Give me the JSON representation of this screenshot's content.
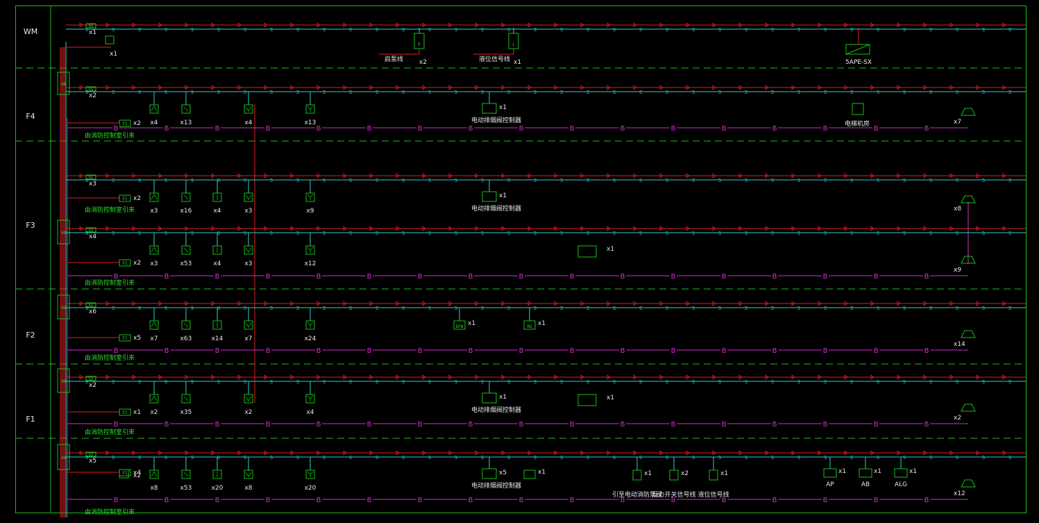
{
  "colors": {
    "border": "#18c018",
    "device": "#28e028",
    "power_line": "#e02020",
    "signal_line": "#2fd0d0",
    "broadcast_line": "#d030d0",
    "label": "#e8e8e8",
    "background": "#000000"
  },
  "line_markers": {
    "signal": "S",
    "power": "D",
    "broadcast": "B",
    "fire": "F"
  },
  "module_labels": {
    "x0": "XO",
    "si": "SI",
    "fi": "FI"
  },
  "floors": [
    "WM",
    "F4",
    "F3",
    "F2",
    "F1"
  ],
  "top_row": {
    "si_count": "x1",
    "phone_count": "x1",
    "devices": [
      {
        "name": "flow-switch",
        "code": "F",
        "note": "启泵线",
        "count": "x2"
      },
      {
        "name": "level-switch",
        "code": "L",
        "note": "液位信号线",
        "count": "x1"
      }
    ],
    "panel": "5APE-SX"
  },
  "floor_rows": [
    {
      "floor": "F4",
      "si_count": "x2",
      "fi_count": "x2",
      "counts": [
        "x4",
        "x13",
        "x4",
        "x13"
      ],
      "controller_count": "x1",
      "controller_label": "电动排烟阀控制器",
      "extra_label": "电梯机房",
      "speaker_count": "x7",
      "note": "由消防控制室引来"
    },
    {
      "floor": "F3-upper",
      "si_count": "x3",
      "fi_count": "x2",
      "counts": [
        "x3",
        "x16",
        "x4",
        "x3",
        "x9"
      ],
      "controller_count": "x1",
      "controller_label": "电动排烟阀控制器",
      "speaker_count": "x8",
      "note": "由消防控制室引来"
    },
    {
      "floor": "F3",
      "si_count": "x4",
      "fi_count": "x2",
      "counts": [
        "x3",
        "x53",
        "x4",
        "x3",
        "x12"
      ],
      "valve_count": "x1",
      "speaker_count": "x9",
      "note": "由消防控制室引来"
    },
    {
      "floor": "F2",
      "si_count": "x6",
      "fi_count": "x5",
      "counts": [
        "x7",
        "x63",
        "x14",
        "x7",
        "x24"
      ],
      "extra_devices": [
        {
          "code": "DFW",
          "count": "x1"
        },
        {
          "code": "RG",
          "count": "x1"
        }
      ],
      "speaker_count": "x14",
      "note": "由消防控制室引来"
    },
    {
      "floor": "F1-upper",
      "si_count": "x2",
      "fi_count": "x1",
      "counts": [
        "x2",
        "x35",
        "x2",
        "x4"
      ],
      "controller_count": "x1",
      "controller_label": "电动排烟阀控制器",
      "valve_count": "x1",
      "speaker_count": "x2",
      "note": "由消防控制室引来"
    },
    {
      "floor": "F1",
      "si_count": "x5",
      "fi_count": "x4",
      "phone_count": "x2",
      "counts": [
        "x8",
        "x53",
        "x20",
        "x8",
        "x20"
      ],
      "controller_count": "x5",
      "controller_label": "电动排烟阀控制器",
      "rg_count": "x1",
      "pump_label": "引至电动消防泵阀",
      "pump_count": "x1",
      "pressure_label": "反力开关信号线",
      "pressure_count": "x2",
      "level_label": "液位信号线",
      "level_count": "x1",
      "ap": {
        "label": "AP",
        "count": "x1"
      },
      "ab": {
        "label": "AB",
        "count": "x1"
      },
      "alg": {
        "label": "ALG",
        "count": "x1"
      },
      "speaker_count": "x12",
      "note": "由消防控制室引来"
    }
  ]
}
